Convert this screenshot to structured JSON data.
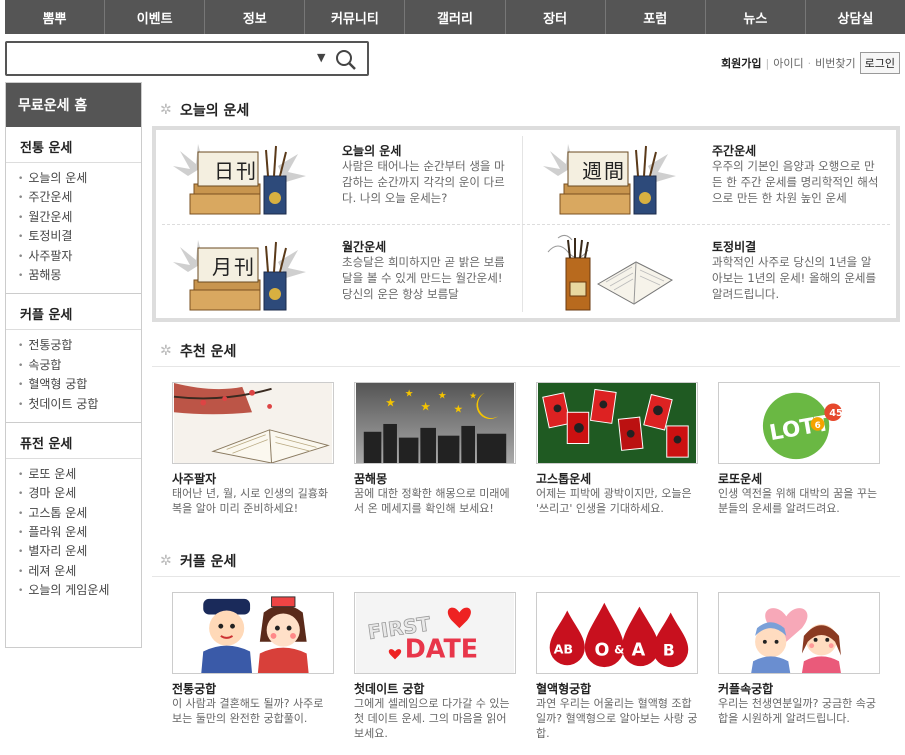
{
  "nav": [
    "뽐뿌",
    "이벤트",
    "정보",
    "커뮤니티",
    "갤러리",
    "장터",
    "포럼",
    "뉴스",
    "상담실"
  ],
  "search": {
    "placeholder": ""
  },
  "usermenu": {
    "join": "회원가입",
    "id": "아이디",
    "dot": "·",
    "pw": "비번찾기",
    "login": "로그인"
  },
  "sidebar": {
    "home": "무료운세 홈",
    "groups": [
      {
        "title": "전통 운세",
        "items": [
          "오늘의 운세",
          "주간운세",
          "월간운세",
          "토정비결",
          "사주팔자",
          "꿈해몽"
        ]
      },
      {
        "title": "커플 운세",
        "items": [
          "전통궁합",
          "속궁합",
          "혈액형 궁합",
          "첫데이트 궁합"
        ]
      },
      {
        "title": "퓨전 운세",
        "items": [
          "로또 운세",
          "경마 운세",
          "고스톱 운세",
          "플라워 운세",
          "별자리 운세",
          "레져 운세",
          "오늘의 게임운세"
        ]
      }
    ]
  },
  "sections": {
    "today": "오늘의 운세",
    "recommend": "추천 운세",
    "couple": "커플 운세"
  },
  "today": [
    {
      "title": "오늘의 운세",
      "desc": "사람은 태어나는 순간부터 생을 마감하는 순간까지 각각의 운이 다르다. 나의 오늘 운세는?",
      "sign": [
        "日",
        "刊"
      ]
    },
    {
      "title": "주간운세",
      "desc": "우주의 기본인 음양과 오행으로 만든 한 주간 운세를 명리학적인 해석으로 만든 한 차원 높인 운세",
      "sign": [
        "週",
        "間"
      ]
    },
    {
      "title": "월간운세",
      "desc": "초승달은 희미하지만 곧 밝은 보름달을 볼 수 있게 만드는 월간운세! 당신의 운은 항상 보름달",
      "sign": [
        "月",
        "刊"
      ]
    },
    {
      "title": "토정비결",
      "desc": "과학적인 사주로 당신의 1년을 알아보는 1년의 운세! 올해의 운세를 알려드립니다.",
      "sign": [
        "",
        ""
      ]
    }
  ],
  "recommend": [
    {
      "title": "사주팔자",
      "desc": "태어난 년, 월, 시로 인생의 길흉화복을 알아 미리 준비하세요!"
    },
    {
      "title": "꿈해몽",
      "desc": "꿈에 대한 정확한 해몽으로 미래에서 온 메세지를 확인해 보세요!"
    },
    {
      "title": "고스톱운세",
      "desc": "어제는 피박에 광박이지만, 오늘은 '쓰리고' 인생을 기대하세요."
    },
    {
      "title": "로또운세",
      "desc": "인생 역전을 위해 대박의 꿈을 꾸는 분들의 운세를 알려드려요.",
      "logo": "LOTTO",
      "num": "6",
      "num2": "45"
    }
  ],
  "couple": [
    {
      "title": "전통궁합",
      "desc": "이 사람과 결혼해도 될까? 사주로 보는 둘만의 완전한 궁합풀이."
    },
    {
      "title": "첫데이트 궁합",
      "desc": "그에게 셀레임으로 다가갈 수 있는 첫 데이트 운세. 그의 마음을 읽어보세요.",
      "line1": "FIRST",
      "line2": "DATE"
    },
    {
      "title": "혈액형궁합",
      "desc": "과연 우리는 어울리는 혈액형 조합일까? 혈액형으로 알아보는 사랑 궁합.",
      "types": [
        "AB",
        "O",
        "&",
        "A",
        "B"
      ]
    },
    {
      "title": "커플속궁합",
      "desc": "우리는 천생연분일까? 궁금한 속궁합을 시원하게 알려드립니다."
    }
  ]
}
